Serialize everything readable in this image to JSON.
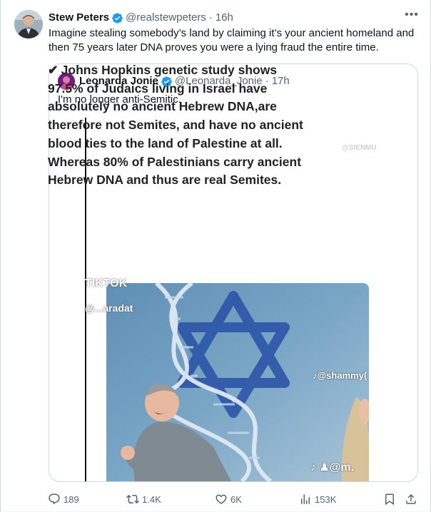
{
  "author": {
    "name": "Stew Peters",
    "handle": "@realstewpeters",
    "time": "16h"
  },
  "tweet_text": "Imagine stealing somebody’s land by claiming it’s your ancient homeland and then 75 years later DNA proves you were a lying fraud the entire time.",
  "more_label": "•••",
  "quote": {
    "name": "Leonarda Jonie",
    "handle": "@Leonarda_Jonie",
    "time": "17h",
    "text": "I'm no longer anti-Semitic.",
    "media_text": "Johns Hopkins genetic study shows 97.5% of Judaics living in Israel have absolutely no ancient Hebrew DNA,are therefore not Semites, and have no ancient blood ties to the land of Palestine at all. Whereas 80% of Palestinians carry ancient Hebrew DNA and thus are real Semites.",
    "media_check": "✔",
    "watermark_top": "@SIENMU",
    "watermark_tiktok": "TIKTOK",
    "watermark_user": "@...aradat",
    "watermark_shammy": "♪@shammy(",
    "watermark_bottom": "♪ ♟@m."
  },
  "actions": {
    "replies": "189",
    "reposts": "1.4K",
    "likes": "6K",
    "views": "153K"
  },
  "icons": [
    "verified-badge-icon",
    "more-icon",
    "reply-icon",
    "repost-icon",
    "like-icon",
    "views-icon",
    "bookmark-icon",
    "share-icon"
  ],
  "colors": {
    "accent": "#1d9bf0",
    "muted": "#536471",
    "border": "#cfd9de"
  }
}
